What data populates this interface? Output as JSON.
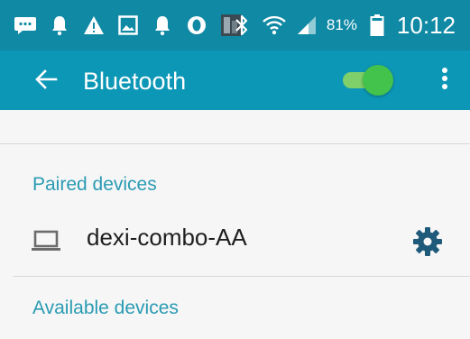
{
  "status_bar": {
    "battery_percent": "81%",
    "time": "10:12",
    "icons": [
      "message-icon",
      "notification-bell-icon",
      "warning-icon",
      "gallery-icon",
      "notification-bell-icon",
      "opera-icon",
      "photo-thumbnail-icon",
      "bluetooth-icon",
      "wifi-icon",
      "signal-icon",
      "battery-icon"
    ]
  },
  "app_bar": {
    "title": "Bluetooth",
    "toggle_state": "on",
    "colors": {
      "bar": "#0d97b6",
      "status": "#0f89a4",
      "toggle": "#43c34b"
    }
  },
  "paired_section": {
    "header": "Paired devices",
    "devices": [
      {
        "name": "dexi-combo-AA",
        "icon": "laptop-icon"
      }
    ]
  },
  "available_section": {
    "header": "Available devices"
  },
  "colors": {
    "accent": "#2a9bb3",
    "background": "#f6f6f6"
  }
}
